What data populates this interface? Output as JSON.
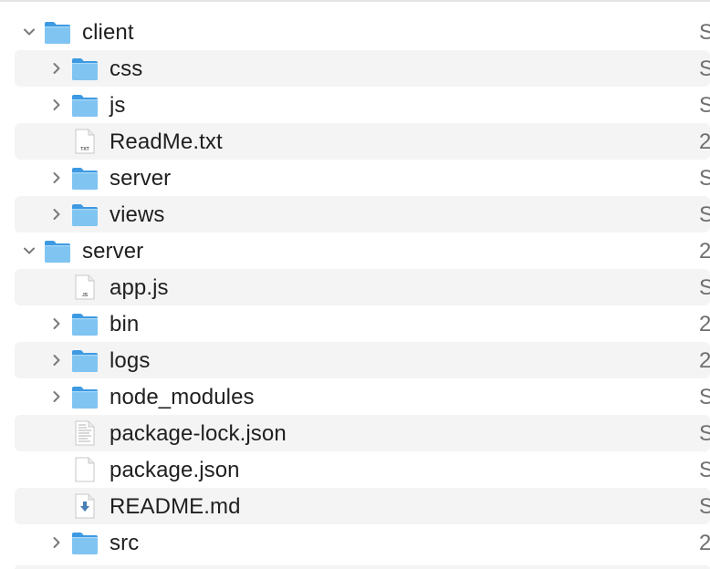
{
  "rows": [
    {
      "name": "client",
      "meta": "S",
      "kind": "folder",
      "level": 0,
      "expanded": true
    },
    {
      "name": "css",
      "meta": "S",
      "kind": "folder",
      "level": 1,
      "expanded": false
    },
    {
      "name": "js",
      "meta": "S",
      "kind": "folder",
      "level": 1,
      "expanded": false
    },
    {
      "name": "ReadMe.txt",
      "meta": "2",
      "kind": "txt-file",
      "level": 1
    },
    {
      "name": "server",
      "meta": "S",
      "kind": "folder",
      "level": 1,
      "expanded": false
    },
    {
      "name": "views",
      "meta": "S",
      "kind": "folder",
      "level": 1,
      "expanded": false
    },
    {
      "name": "server",
      "meta": "2",
      "kind": "folder",
      "level": 0,
      "expanded": true
    },
    {
      "name": "app.js",
      "meta": "S",
      "kind": "js-file",
      "level": 1
    },
    {
      "name": "bin",
      "meta": "2",
      "kind": "folder",
      "level": 1,
      "expanded": false
    },
    {
      "name": "logs",
      "meta": "2",
      "kind": "folder",
      "level": 1,
      "expanded": false
    },
    {
      "name": "node_modules",
      "meta": "S",
      "kind": "folder",
      "level": 1,
      "expanded": false
    },
    {
      "name": "package-lock.json",
      "meta": "S",
      "kind": "json-file",
      "level": 1
    },
    {
      "name": "package.json",
      "meta": "S",
      "kind": "blank-file",
      "level": 1
    },
    {
      "name": "README.md",
      "meta": "S",
      "kind": "md-file",
      "level": 1
    },
    {
      "name": "src",
      "meta": "2",
      "kind": "folder",
      "level": 1,
      "expanded": false
    }
  ]
}
